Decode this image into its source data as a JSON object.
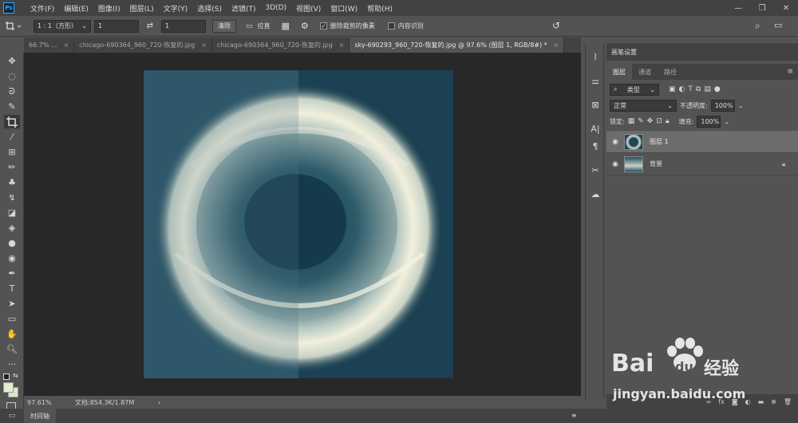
{
  "app": {
    "logo": "Ps"
  },
  "menu": [
    "文件(F)",
    "编辑(E)",
    "图像(I)",
    "图层(L)",
    "文字(Y)",
    "选择(S)",
    "滤镜(T)",
    "3D(D)",
    "视图(V)",
    "窗口(W)",
    "帮助(H)"
  ],
  "window_controls": {
    "minimize": "—",
    "maximize": "❐",
    "close": "✕"
  },
  "options": {
    "ratio": "1 : 1（方形）",
    "width_value": "1",
    "height_value": "1",
    "clear_label": "清除",
    "straighten_label": "拉直",
    "delete_cropped_label": "删除裁剪的像素",
    "content_aware_label": "内容识别"
  },
  "tabs": [
    {
      "label": "66.7% ...",
      "close": "×"
    },
    {
      "label": "chicago-690364_960_720-恢复的.jpg",
      "close": "×"
    },
    {
      "label": "chicago-690364_960_720-恢复的.jpg",
      "close": "×"
    },
    {
      "label": "sky-690293_960_720-恢复的.jpg @ 97.6% (图层 1, RGB/8#) *",
      "close": "×"
    }
  ],
  "status": {
    "zoom": "97.61%",
    "doc": "文档:854.3K/1.87M",
    "arrow": "›"
  },
  "timeline": {
    "label": "时间轴"
  },
  "panel": {
    "brush_settings": "画笔设置",
    "tabs": [
      "图层",
      "通道",
      "路径"
    ],
    "kind": "类型",
    "blend_mode": "正常",
    "opacity_label": "不透明度:",
    "opacity_value": "100%",
    "lock_label": "锁定:",
    "fill_label": "填充:",
    "fill_value": "100%",
    "layers": [
      {
        "name": "图层 1",
        "selected": true
      },
      {
        "name": "背景",
        "selected": false
      }
    ]
  },
  "watermark": {
    "brand": "Bai",
    "du": "du",
    "jingyan": "经验",
    "url": "jingyan.baidu.com"
  },
  "colors": {
    "accent": "#31a8ff",
    "canvas_bg": "#282828",
    "panel_bg": "#535353"
  }
}
